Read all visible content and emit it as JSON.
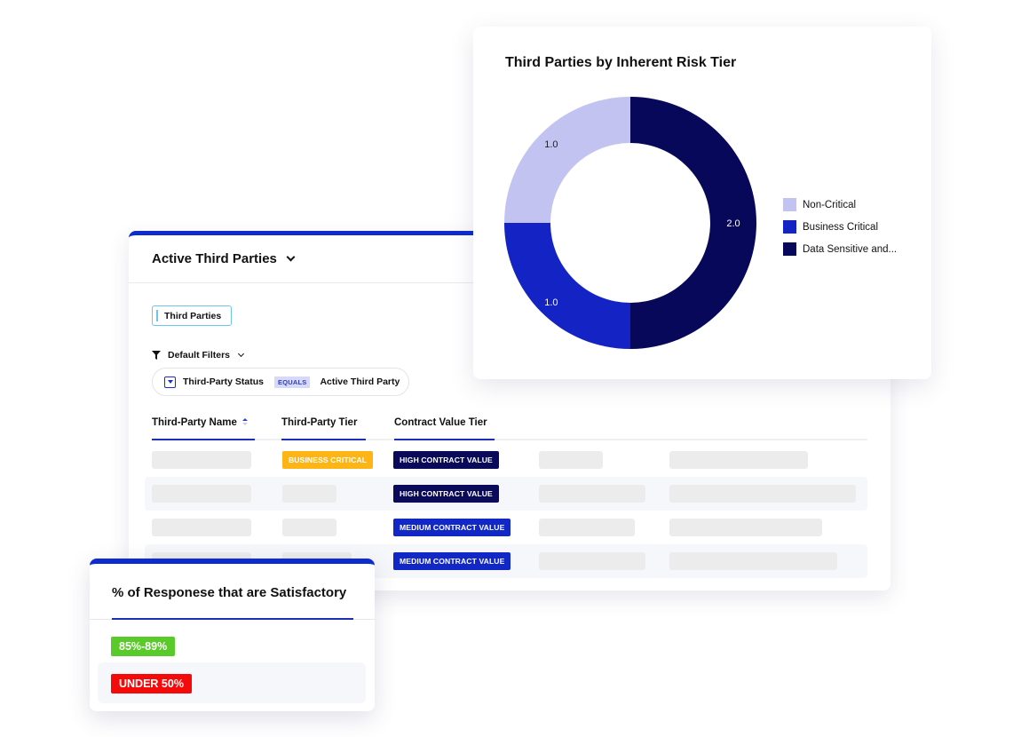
{
  "table_card": {
    "title": "Active Third Parties",
    "tab_label": "Third Parties",
    "filters_label": "Default Filters",
    "filter": {
      "field": "Third-Party Status",
      "operator": "EQUALS",
      "value": "Active Third Party"
    },
    "columns": [
      "Third-Party Name",
      "Third-Party Tier",
      "Contract Value Tier"
    ],
    "rows": [
      {
        "tier": "BUSINESS CRITICAL",
        "contract_value": "HIGH CONTRACT VALUE"
      },
      {
        "tier": "",
        "contract_value": "HIGH CONTRACT VALUE"
      },
      {
        "tier": "",
        "contract_value": "MEDIUM CONTRACT VALUE"
      },
      {
        "tier": "",
        "contract_value": "MEDIUM CONTRACT VALUE"
      }
    ],
    "accent_color": "#0c2cd1"
  },
  "chart_data": {
    "type": "pie",
    "title": "Third Parties by Inherent Risk Tier",
    "donut": true,
    "categories": [
      "Non-Critical",
      "Business Critical",
      "Data Sensitive and..."
    ],
    "values": [
      1.0,
      1.0,
      2.0
    ],
    "data_labels": [
      "1.0",
      "1.0",
      "2.0"
    ],
    "colors": [
      "#c3c3f2",
      "#1424c4",
      "#08085a"
    ],
    "legend_position": "right"
  },
  "sat_card": {
    "title": "% of Responese that are Satisfactory",
    "items": [
      {
        "label": "85%-89%",
        "color": "#5ac92a"
      },
      {
        "label": "UNDER 50%",
        "color": "#f50a0a"
      }
    ]
  }
}
